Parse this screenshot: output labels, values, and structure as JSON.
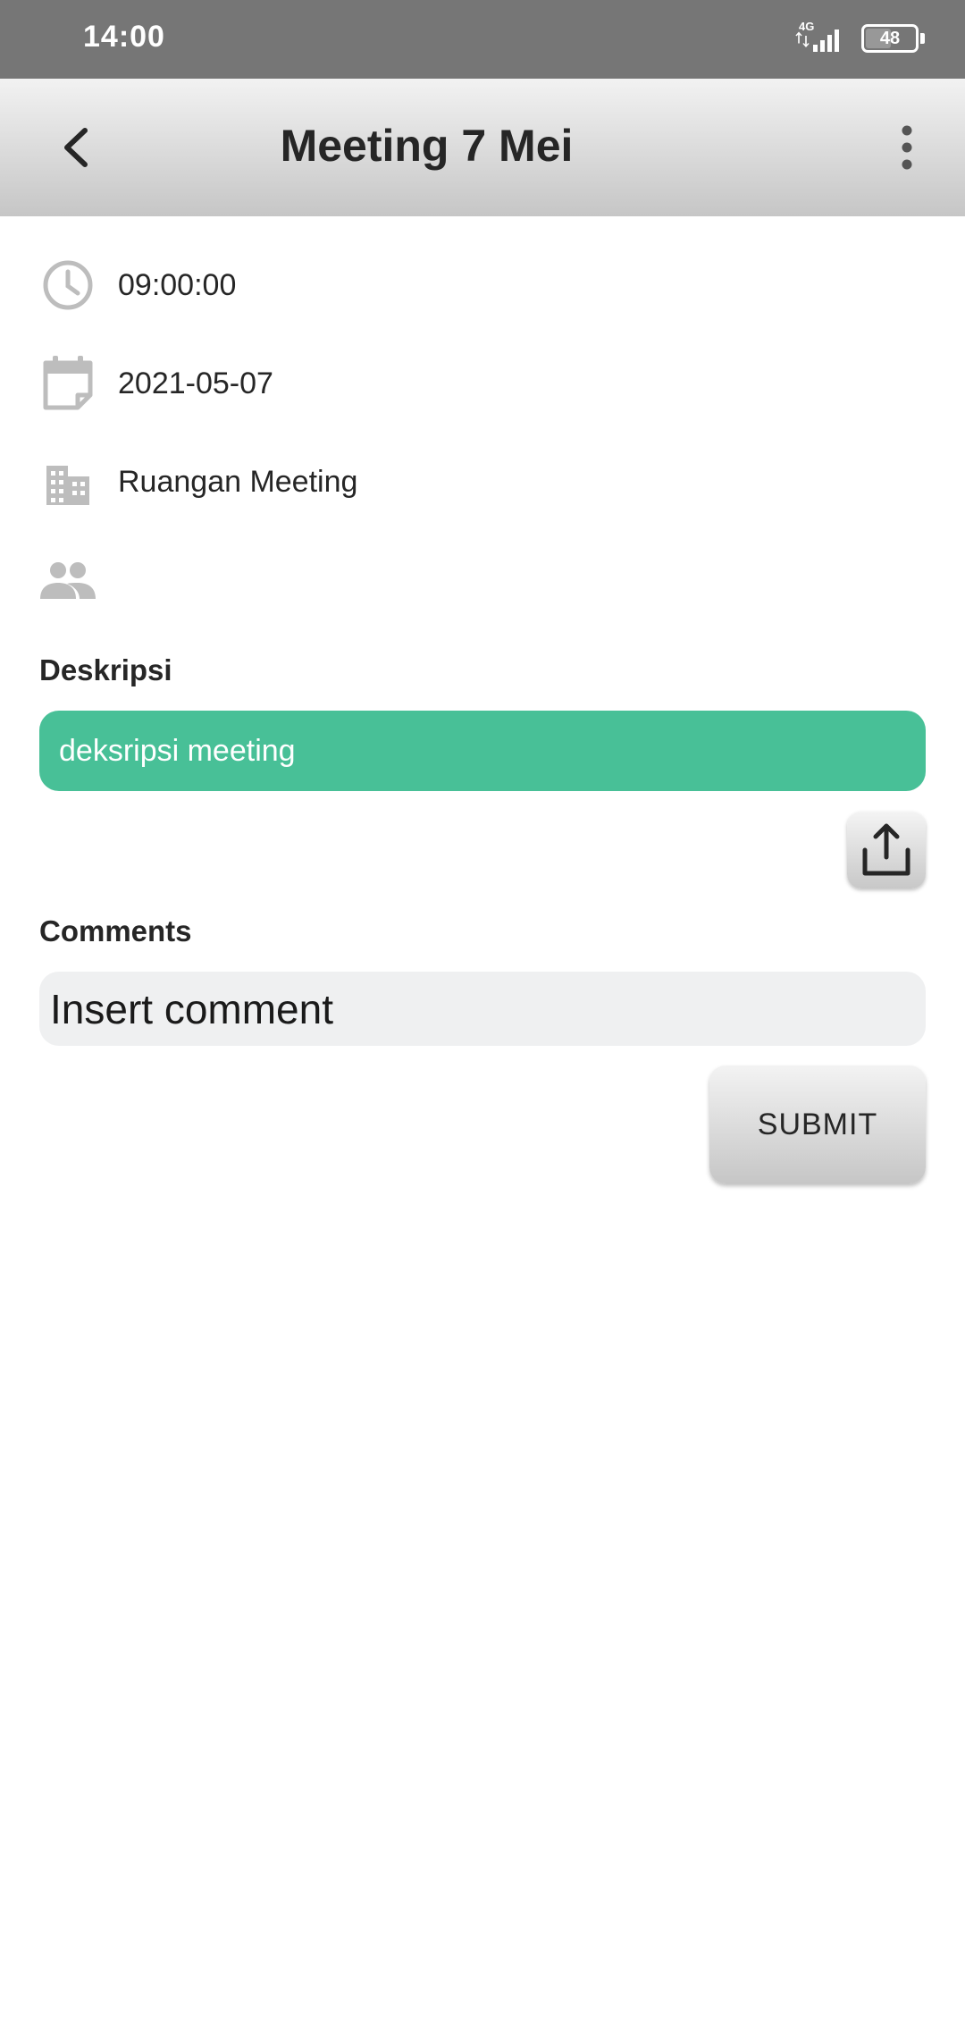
{
  "status_bar": {
    "time": "14:00",
    "network": "4G",
    "battery_level": "48"
  },
  "app_bar": {
    "title": "Meeting 7 Mei",
    "back_icon": "chevron-left-icon",
    "more_icon": "more-vertical-icon"
  },
  "details": {
    "time": "09:00:00",
    "date": "2021-05-07",
    "location": "Ruangan Meeting",
    "participants": ""
  },
  "description": {
    "label": "Deskripsi",
    "text": "deksripsi meeting"
  },
  "comments": {
    "label": "Comments",
    "placeholder": "Insert comment",
    "submit_label": "SUBMIT"
  },
  "colors": {
    "status_bar": "#767676",
    "accent_green": "#48c097",
    "icon_gray": "#bdbdbd"
  }
}
